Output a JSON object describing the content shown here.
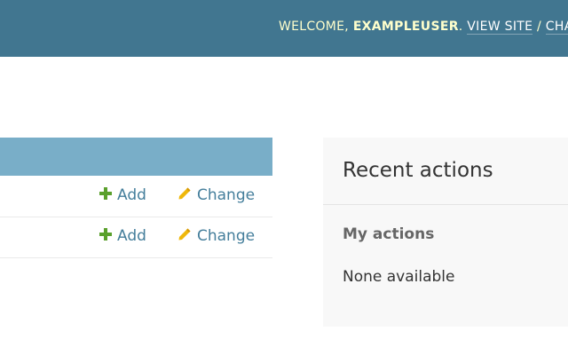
{
  "header": {
    "welcome_prefix": "WELCOME, ",
    "username": "EXAMPLEUSER",
    "welcome_suffix": ". ",
    "view_site": "VIEW SITE",
    "separator": " / ",
    "change_password": "CHA"
  },
  "models": [
    {
      "add_label": "Add",
      "change_label": "Change"
    },
    {
      "add_label": "Add",
      "change_label": "Change"
    }
  ],
  "recent_actions": {
    "title": "Recent actions",
    "my_actions": "My actions",
    "empty": "None available"
  },
  "colors": {
    "header_bg": "#417690",
    "caption_bg": "#79aec8",
    "add_icon": "#5aa02c",
    "change_icon": "#efb80b",
    "link": "#447e9b"
  },
  "icons": {
    "add": "plus-icon",
    "change": "pencil-icon"
  }
}
